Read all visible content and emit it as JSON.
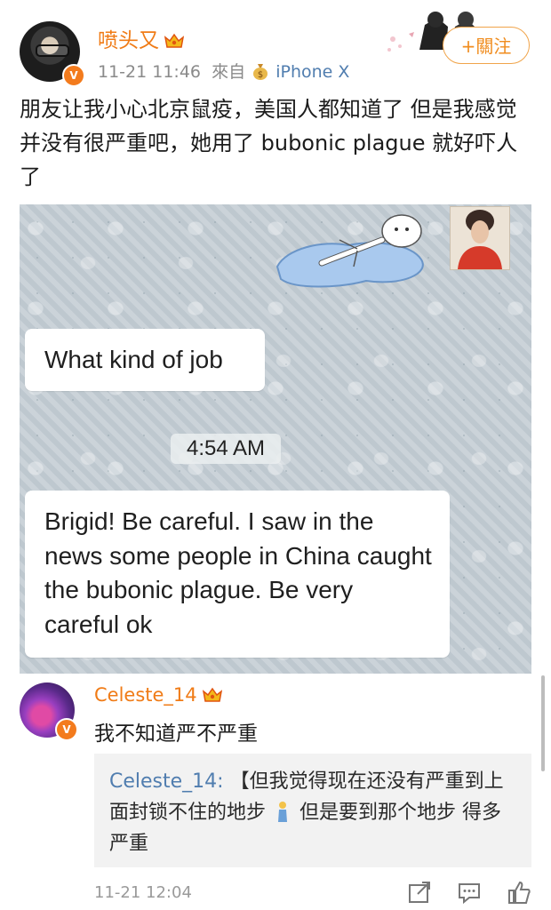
{
  "post": {
    "username": "喷头又",
    "time": "11-21 11:46",
    "source_prefix": "來自",
    "device": "iPhone X",
    "follow_label": "+關注",
    "text": "朋友让我小心北京鼠疫，美国人都知道了 但是我感觉并没有很严重吧，她用了 bubonic plague 就好吓人了"
  },
  "chat": {
    "message1": "What kind of job",
    "time": "4:54 AM",
    "message2": "Brigid! Be careful. I saw in the news some people in China caught the bubonic plague. Be very careful ok"
  },
  "comment": {
    "username": "Celeste_14",
    "text": "我不知道严不严重",
    "reply_author": "Celeste_14",
    "reply_colon": ":",
    "reply_part1": "【但我觉得现在还没有严重到上面封锁不住的地步",
    "reply_part2": "但是要到那个地步 得多严重",
    "time": "11-21 12:04"
  },
  "icons": {
    "verified_badge": "verified-v-icon",
    "crown": "crown-icon",
    "repost": "repost-icon",
    "comment": "comment-icon",
    "like": "thumbs-up-icon"
  },
  "colors": {
    "username": "#f07b16",
    "link": "#507daf",
    "meta": "#8a8a8a"
  }
}
